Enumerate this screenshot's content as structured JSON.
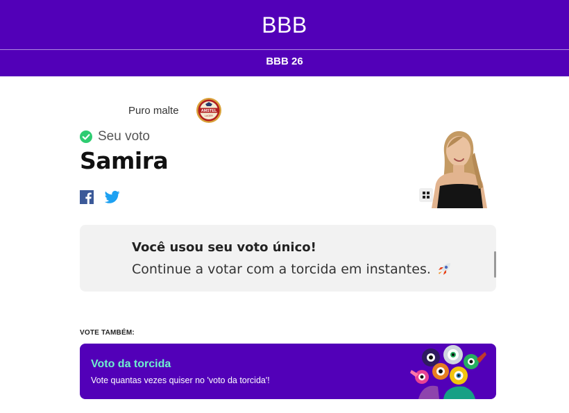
{
  "header": {
    "brand": "BBB",
    "subnav_title": "BBB 26",
    "color": "#5200b8"
  },
  "sponsor": {
    "label": "Puro malte",
    "logo_name": "amstel-logo"
  },
  "vote": {
    "status_label": "Seu voto",
    "status_icon": "check-circle-icon",
    "status_color": "#2ecc71",
    "candidate": "Samira"
  },
  "share": {
    "icons": [
      "facebook-icon",
      "twitter-icon"
    ]
  },
  "notice": {
    "title": "Você usou seu voto único!",
    "text": "Continue a votar com a torcida em instantes.",
    "icon": "rocket-icon"
  },
  "vote_also": {
    "label": "VOTE TAMBÉM:",
    "card_title": "Voto da torcida",
    "card_text": "Vote quantas vezes quiser no 'voto da torcida'!",
    "title_color": "#6ff0cf"
  }
}
